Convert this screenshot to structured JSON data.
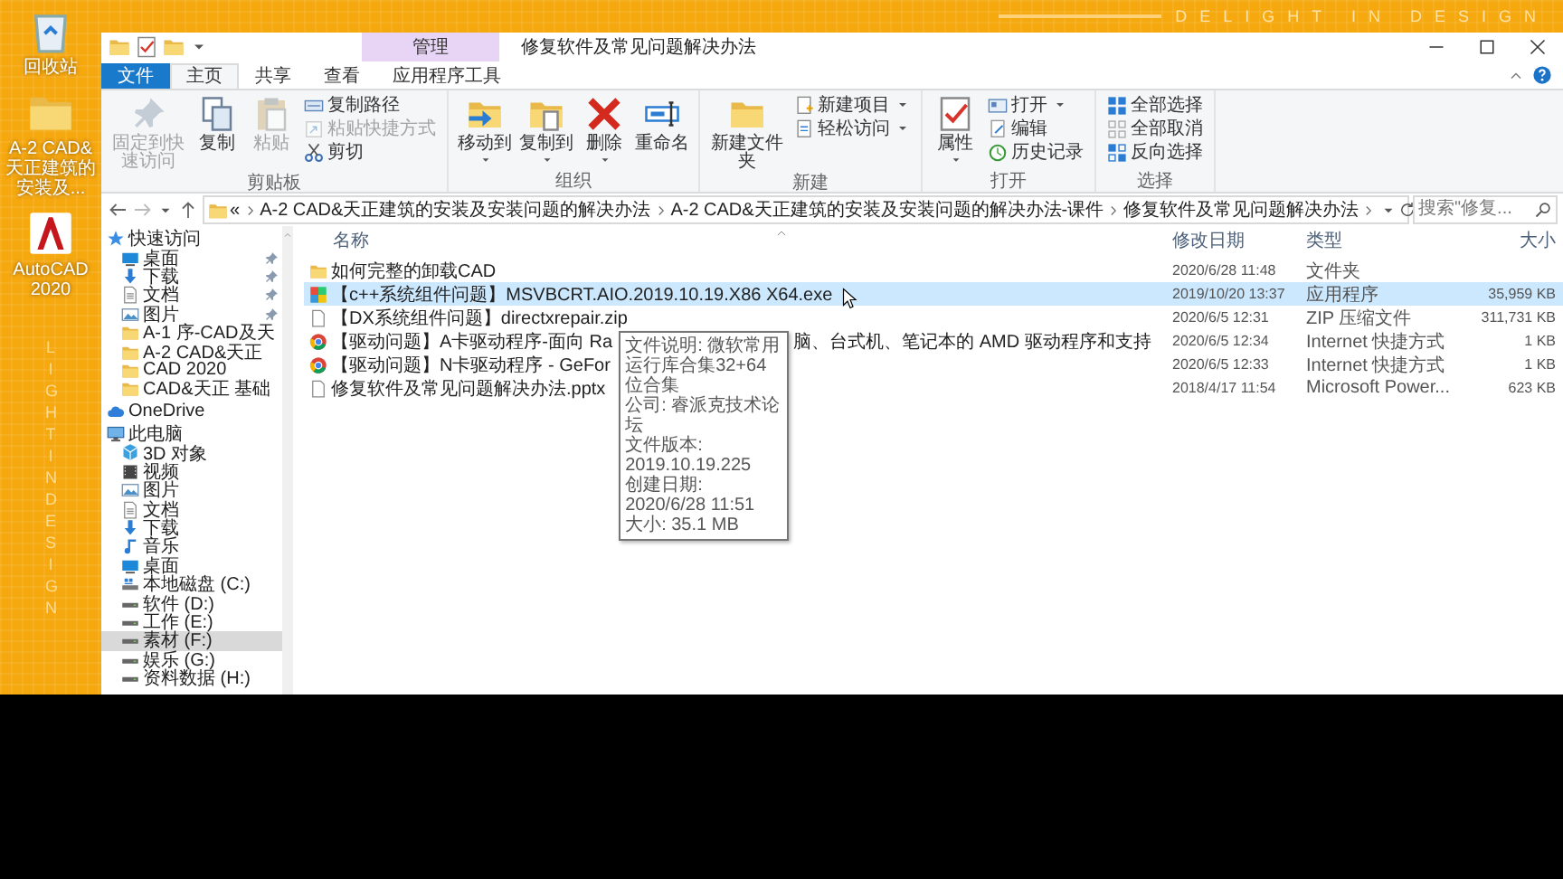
{
  "desktop": {
    "icons": [
      {
        "kind": "recycle",
        "label": "回收站"
      },
      {
        "kind": "folder",
        "label": "A-2 CAD&天正建筑的安装及..."
      },
      {
        "kind": "app",
        "label": "AutoCAD 2020"
      }
    ],
    "top_banner": "DELIGHT IN DESIGN",
    "side_banner": "LIGHT IN DESIGN"
  },
  "window": {
    "title": "修复软件及常见问题解决办法",
    "context_tab": "管理",
    "tabs": [
      {
        "label": "文件",
        "kind": "file",
        "selected": false
      },
      {
        "label": "主页",
        "kind": "tab",
        "selected": true
      },
      {
        "label": "共享",
        "kind": "tab",
        "selected": false
      },
      {
        "label": "查看",
        "kind": "tab",
        "selected": false
      },
      {
        "label": "应用程序工具",
        "kind": "tab",
        "selected": false
      }
    ],
    "ribbon": [
      {
        "label": "剪贴板",
        "items": [
          {
            "label": "固定到快速访问",
            "kind": "large",
            "disabled": true,
            "dropdown": false
          },
          {
            "label": "复制",
            "kind": "large",
            "disabled": false,
            "dropdown": false
          },
          {
            "label": "粘贴",
            "kind": "large",
            "disabled": true,
            "dropdown": false
          },
          {
            "label": "复制路径",
            "kind": "small",
            "disabled": false,
            "dropdown": false
          },
          {
            "label": "粘贴快捷方式",
            "kind": "small",
            "disabled": true,
            "dropdown": false
          },
          {
            "label": "剪切",
            "kind": "small",
            "disabled": false,
            "dropdown": false
          }
        ]
      },
      {
        "label": "组织",
        "items": [
          {
            "label": "移动到",
            "kind": "large",
            "disabled": false,
            "dropdown": true
          },
          {
            "label": "复制到",
            "kind": "large",
            "disabled": false,
            "dropdown": true
          },
          {
            "label": "删除",
            "kind": "large",
            "disabled": false,
            "dropdown": true
          },
          {
            "label": "重命名",
            "kind": "large",
            "disabled": false,
            "dropdown": false
          }
        ]
      },
      {
        "label": "新建",
        "items": [
          {
            "label": "新建文件夹",
            "kind": "large",
            "disabled": false,
            "dropdown": false
          },
          {
            "label": "新建项目",
            "kind": "small",
            "disabled": false,
            "dropdown": true
          },
          {
            "label": "轻松访问",
            "kind": "small",
            "disabled": false,
            "dropdown": true
          }
        ]
      },
      {
        "label": "打开",
        "items": [
          {
            "label": "属性",
            "kind": "large",
            "disabled": false,
            "dropdown": true
          },
          {
            "label": "打开",
            "kind": "small",
            "disabled": false,
            "dropdown": true
          },
          {
            "label": "编辑",
            "kind": "small",
            "disabled": false,
            "dropdown": false
          },
          {
            "label": "历史记录",
            "kind": "small",
            "disabled": false,
            "dropdown": false
          }
        ]
      },
      {
        "label": "选择",
        "items": [
          {
            "label": "全部选择",
            "kind": "small",
            "disabled": false,
            "dropdown": false
          },
          {
            "label": "全部取消",
            "kind": "small",
            "disabled": false,
            "dropdown": false
          },
          {
            "label": "反向选择",
            "kind": "small",
            "disabled": false,
            "dropdown": false
          }
        ]
      }
    ],
    "address": {
      "overflow": "«",
      "crumbs": [
        "A-2 CAD&天正建筑的安装及安装问题的解决办法",
        "A-2 CAD&天正建筑的安装及安装问题的解决办法-课件",
        "修复软件及常见问题解决办法"
      ],
      "search_placeholder": "搜索\"修复..."
    },
    "nav_pane": [
      {
        "label": "快速访问",
        "kind": "star",
        "selected": false,
        "children": [
          {
            "label": "桌面",
            "kind": "desktop",
            "pinned": true,
            "selected": false
          },
          {
            "label": "下载",
            "kind": "download",
            "pinned": true,
            "selected": false
          },
          {
            "label": "文档",
            "kind": "documents",
            "pinned": true,
            "selected": false
          },
          {
            "label": "图片",
            "kind": "pictures",
            "pinned": true,
            "selected": false
          },
          {
            "label": "A-1 序-CAD及天",
            "kind": "folder",
            "pinned": false,
            "selected": false
          },
          {
            "label": "A-2 CAD&天正",
            "kind": "folder",
            "pinned": false,
            "selected": false
          },
          {
            "label": "CAD 2020",
            "kind": "folder",
            "pinned": false,
            "selected": false
          },
          {
            "label": "CAD&天正 基础",
            "kind": "folder",
            "pinned": false,
            "selected": false
          }
        ]
      },
      {
        "label": "OneDrive",
        "kind": "cloud",
        "selected": false
      },
      {
        "label": "此电脑",
        "kind": "pc",
        "selected": false,
        "children": [
          {
            "label": "3D 对象",
            "kind": "objects3d",
            "selected": false
          },
          {
            "label": "视频",
            "kind": "videos",
            "selected": false
          },
          {
            "label": "图片",
            "kind": "pictures",
            "selected": false
          },
          {
            "label": "文档",
            "kind": "documents",
            "selected": false
          },
          {
            "label": "下载",
            "kind": "download",
            "selected": false
          },
          {
            "label": "音乐",
            "kind": "music",
            "selected": false
          },
          {
            "label": "桌面",
            "kind": "desktop",
            "selected": false
          },
          {
            "label": "本地磁盘 (C:)",
            "kind": "system-disk",
            "selected": false
          },
          {
            "label": "软件 (D:)",
            "kind": "drive",
            "selected": false
          },
          {
            "label": "工作 (E:)",
            "kind": "drive",
            "selected": false
          },
          {
            "label": "素材 (F:)",
            "kind": "drive",
            "selected": true
          },
          {
            "label": "娱乐 (G:)",
            "kind": "drive",
            "selected": false
          },
          {
            "label": "资料数据 (H:)",
            "kind": "drive",
            "selected": false
          }
        ]
      }
    ],
    "files": {
      "columns": [
        "名称",
        "修改日期",
        "类型",
        "大小"
      ],
      "rows": [
        {
          "kind": "folder",
          "name": "如何完整的卸载CAD",
          "date": "2020/6/28 11:48",
          "type": "文件夹",
          "selected": false,
          "hovered": false
        },
        {
          "kind": "exe",
          "name": "【c++系统组件问题】MSVBCRT.AIO.2019.10.19.X86 X64.exe",
          "date": "2019/10/20 13:37",
          "type": "应用程序",
          "size": "35,959 KB",
          "selected": true,
          "hovered": true
        },
        {
          "kind": "zip",
          "name": "【DX系统组件问题】directxrepair.zip",
          "date": "2020/6/5 12:31",
          "type": "ZIP 压缩文件",
          "size": "311,731 KB",
          "selected": false,
          "hovered": false
        },
        {
          "kind": "link",
          "name": "【驱动问题】A卡驱动程序-面向 Ra",
          "name_tail": "脑、台式机、笔记本的 AMD 驱动程序和支持",
          "date": "2020/6/5 12:34",
          "type": "Internet 快捷方式",
          "size": "1 KB",
          "selected": false,
          "hovered": false
        },
        {
          "kind": "link",
          "name": "【驱动问题】N卡驱动程序 - GeFor",
          "date": "2020/6/5 12:33",
          "type": "Internet 快捷方式",
          "size": "1 KB",
          "selected": false,
          "hovered": false
        },
        {
          "kind": "doc",
          "name": "修复软件及常见问题解决办法.pptx",
          "date": "2018/4/17 11:54",
          "type": "Microsoft Power...",
          "size": "623 KB",
          "selected": false,
          "hovered": false
        }
      ],
      "hover_tooltip": [
        "文件说明: 微软常用运行库合集32+64位合集",
        "公司: 睿派克技术论坛",
        "文件版本: 2019.10.19.225",
        "创建日期: 2020/6/28 11:51",
        "大小: 35.1 MB"
      ]
    }
  }
}
